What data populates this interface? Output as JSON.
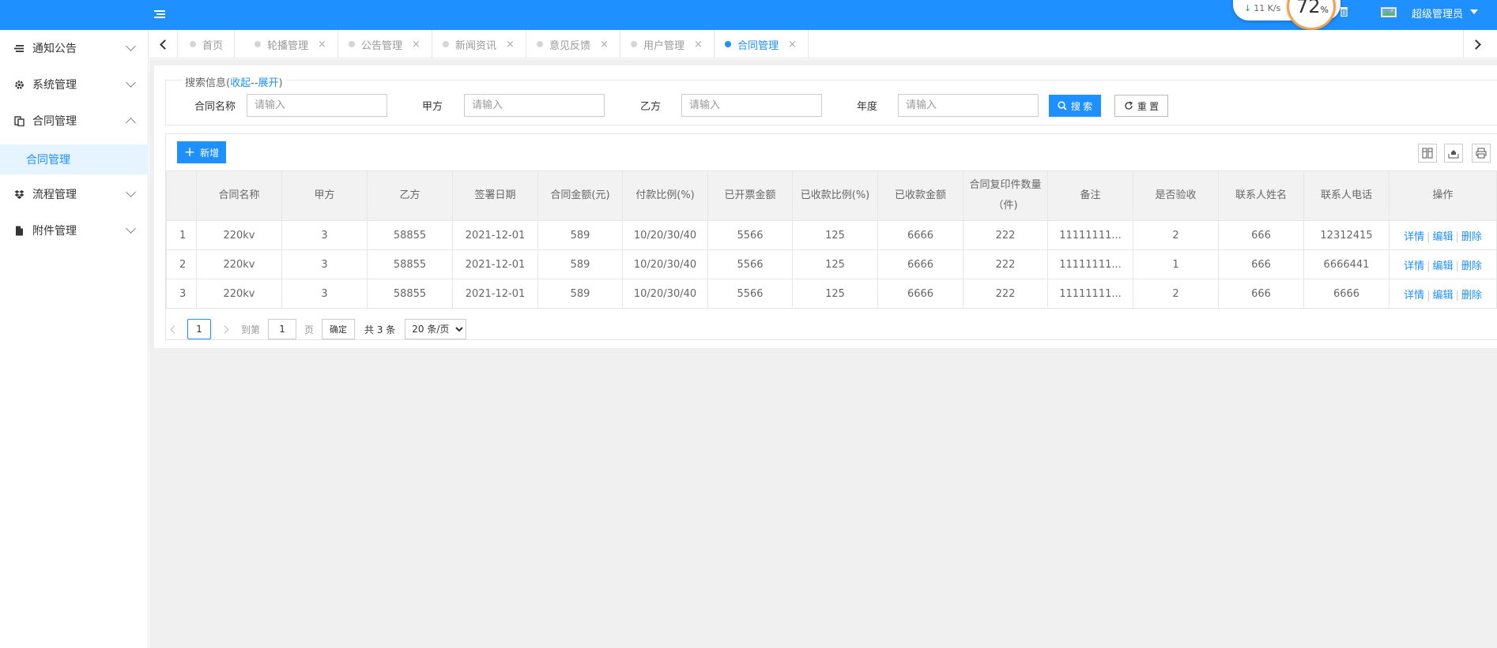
{
  "header": {
    "speed_value": "11",
    "speed_unit": "K/s",
    "gauge_value": "72",
    "gauge_unit": "%",
    "user_name": "超级管理员",
    "brand_color": "#1e90ff"
  },
  "sidebar": {
    "items": [
      {
        "label": "通知公告",
        "icon": "list-icon",
        "expanded": false
      },
      {
        "label": "系统管理",
        "icon": "gear-icon",
        "expanded": false
      },
      {
        "label": "合同管理",
        "icon": "document-icon",
        "expanded": true
      },
      {
        "label": "流程管理",
        "icon": "dropbox-icon",
        "expanded": false
      },
      {
        "label": "附件管理",
        "icon": "file-icon",
        "expanded": false
      }
    ],
    "subitem": {
      "label": "合同管理",
      "active": true
    }
  },
  "tabs": [
    {
      "label": "首页",
      "closable": false,
      "active": false
    },
    {
      "label": "轮播管理",
      "closable": true,
      "active": false
    },
    {
      "label": "公告管理",
      "closable": true,
      "active": false
    },
    {
      "label": "新闻资讯",
      "closable": true,
      "active": false
    },
    {
      "label": "意见反馈",
      "closable": true,
      "active": false
    },
    {
      "label": "用户管理",
      "closable": true,
      "active": false
    },
    {
      "label": "合同管理",
      "closable": true,
      "active": true
    }
  ],
  "search": {
    "legend_prefix": "搜索信息(",
    "collapse_label": "收起",
    "legend_sep": "--",
    "expand_label": "展开",
    "legend_suffix": ")",
    "fields": [
      {
        "label": "合同名称",
        "placeholder": "请输入"
      },
      {
        "label": "甲方",
        "placeholder": "请输入"
      },
      {
        "label": "乙方",
        "placeholder": "请输入"
      },
      {
        "label": "年度",
        "placeholder": "请输入"
      }
    ],
    "search_button": "搜 索",
    "reset_button": "重 置"
  },
  "toolbar": {
    "add_button": "新增",
    "close_x": "×"
  },
  "table": {
    "headers": [
      "",
      "合同名称",
      "甲方",
      "乙方",
      "签署日期",
      "合同金额(元)",
      "付款比例(%)",
      "已开票金额",
      "已收款比例(%)",
      "已收款金额",
      "合同复印件数量（件)",
      "备注",
      "是否验收",
      "联系人姓名",
      "联系人电话",
      "操作"
    ],
    "rows": [
      [
        "1",
        "220kv",
        "3",
        "58855",
        "2021-12-01",
        "589",
        "10/20/30/40",
        "5566",
        "125",
        "6666",
        "222",
        "11111111...",
        "2",
        "666",
        "12312415"
      ],
      [
        "2",
        "220kv",
        "3",
        "58855",
        "2021-12-01",
        "589",
        "10/20/30/40",
        "5566",
        "125",
        "6666",
        "222",
        "11111111...",
        "1",
        "666",
        "6666441"
      ],
      [
        "3",
        "220kv",
        "3",
        "58855",
        "2021-12-01",
        "589",
        "10/20/30/40",
        "5566",
        "125",
        "6666",
        "222",
        "11111111...",
        "2",
        "666",
        "6666"
      ]
    ],
    "row_actions": [
      "详情",
      "编辑",
      "删除"
    ]
  },
  "pager": {
    "current_page": "1",
    "goto_prefix": "到第",
    "goto_value": "1",
    "goto_suffix": "页",
    "confirm_button": "确定",
    "total_text": "共 3 条",
    "page_size": "20 条/页"
  }
}
